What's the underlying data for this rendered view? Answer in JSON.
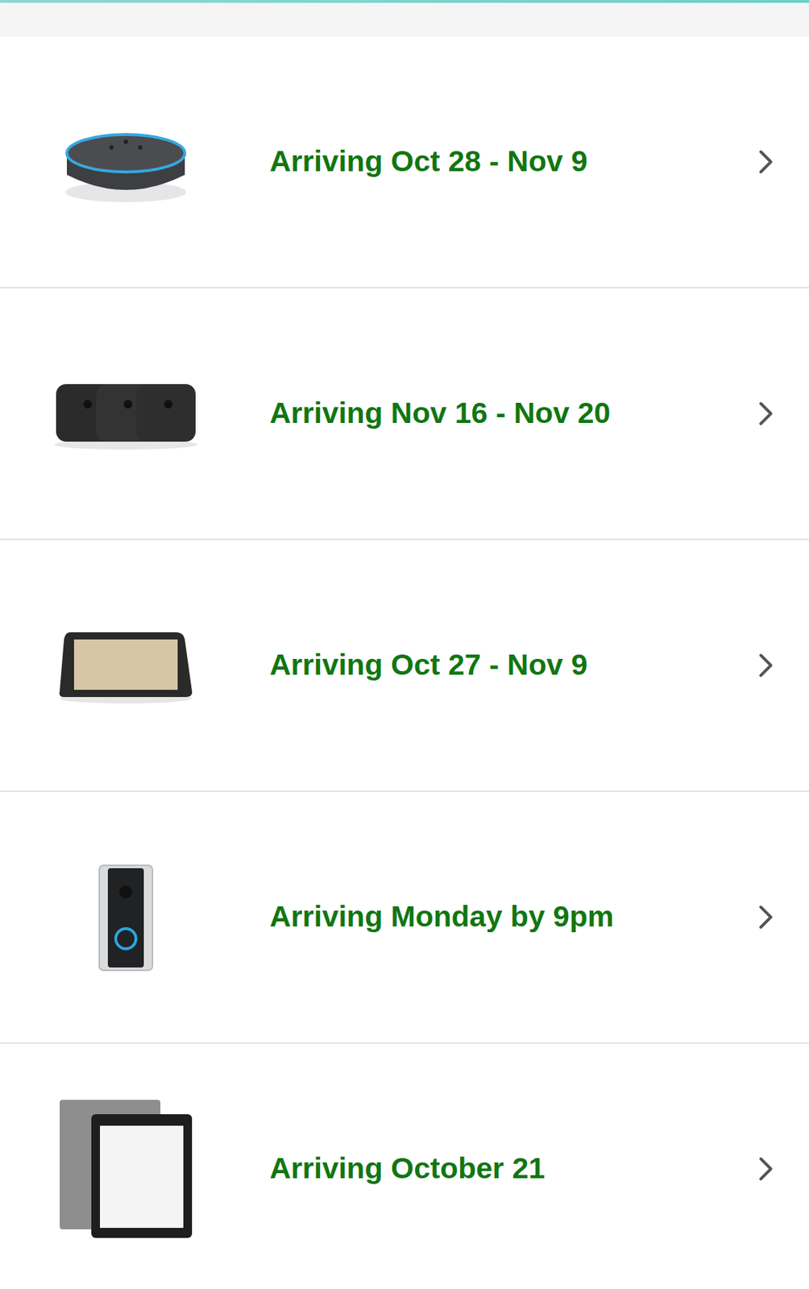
{
  "orders": [
    {
      "status": "Arriving Oct 28 - Nov 9"
    },
    {
      "status": "Arriving Nov 16 - Nov 20"
    },
    {
      "status": "Arriving Oct 27 - Nov 9"
    },
    {
      "status": "Arriving Monday by 9pm"
    },
    {
      "status": "Arriving October 21"
    }
  ]
}
